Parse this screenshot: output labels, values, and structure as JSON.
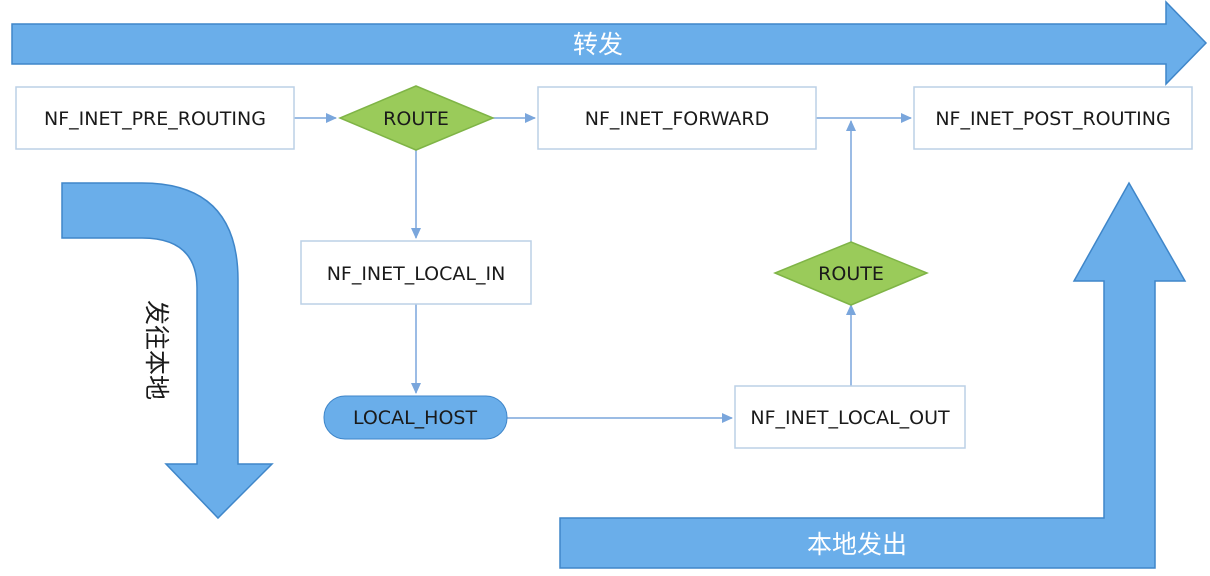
{
  "colors": {
    "big_arrow_fill": "#6aaeea",
    "big_arrow_stroke": "#3f86c9",
    "diamond_fill": "#9acb5a",
    "diamond_stroke": "#7fb446",
    "pill_fill": "#6aaeea",
    "connector": "#7aa6dc",
    "box_stroke": "#bcd0e6"
  },
  "arrows": {
    "forward_label": "转发",
    "local_in_label": "发往本地",
    "local_out_label": "本地发出"
  },
  "nodes": {
    "pre_routing": "NF_INET_PRE_ROUTING",
    "route_top": "ROUTE",
    "forward": "NF_INET_FORWARD",
    "post_routing": "NF_INET_POST_ROUTING",
    "local_in": "NF_INET_LOCAL_IN",
    "route_bottom": "ROUTE",
    "local_host": "LOCAL_HOST",
    "local_out": "NF_INET_LOCAL_OUT"
  }
}
